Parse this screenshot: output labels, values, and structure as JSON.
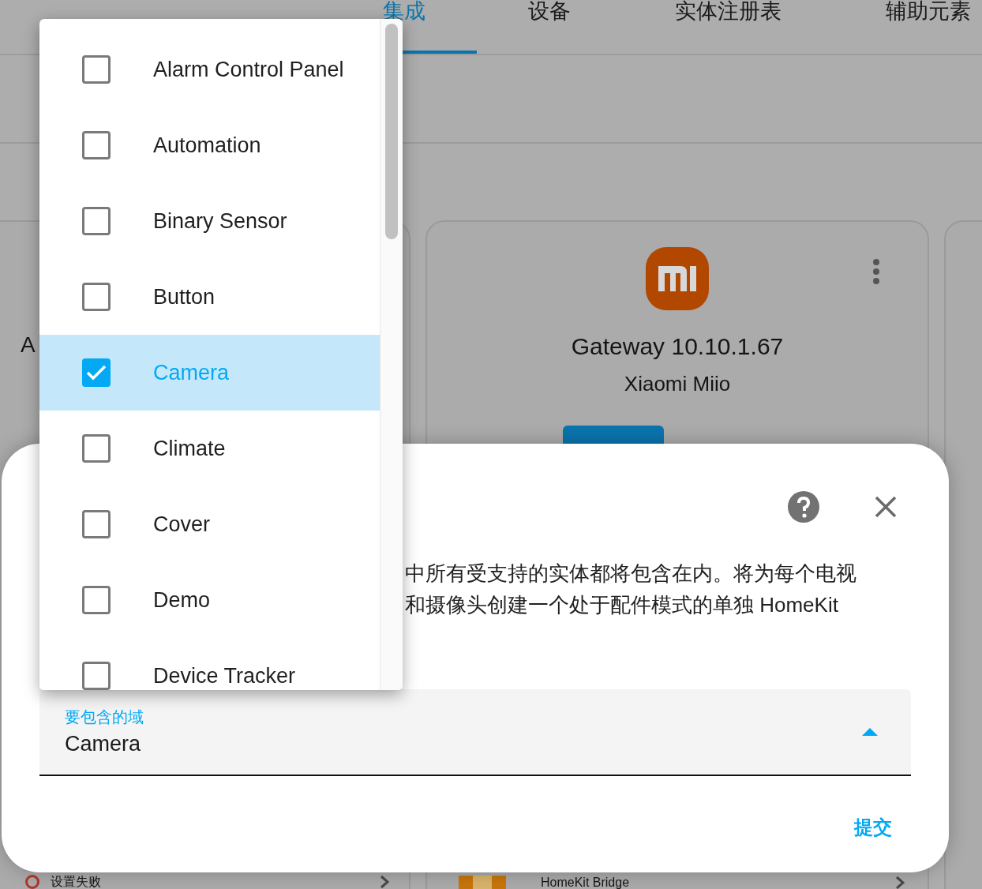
{
  "tabs": [
    {
      "label": "集成",
      "selected": true
    },
    {
      "label": "设备",
      "selected": false
    },
    {
      "label": "实体注册表",
      "selected": false
    },
    {
      "label": "辅助元素",
      "selected": false
    }
  ],
  "left_card": {
    "title": "A",
    "status": "设置失败"
  },
  "gateway_card": {
    "title": "Gateway 10.10.1.67",
    "subtitle": "Xiaomi Miio",
    "entry": "HomeKit Bridge"
  },
  "dialog": {
    "description_lines": [
      "中所有受支持的实体都将包含在内。将为每个电视",
      "和摄像头创建一个处于配件模式的单独 HomeKit"
    ],
    "select": {
      "label": "要包含的域",
      "value": "Camera",
      "expanded": true
    },
    "submit": "提交"
  },
  "dropdown": {
    "options": [
      {
        "label": "Alarm Control Panel",
        "checked": false,
        "selected": false
      },
      {
        "label": "Automation",
        "checked": false,
        "selected": false
      },
      {
        "label": "Binary Sensor",
        "checked": false,
        "selected": false
      },
      {
        "label": "Button",
        "checked": false,
        "selected": false
      },
      {
        "label": "Camera",
        "checked": true,
        "selected": true
      },
      {
        "label": "Climate",
        "checked": false,
        "selected": false
      },
      {
        "label": "Cover",
        "checked": false,
        "selected": false
      },
      {
        "label": "Demo",
        "checked": false,
        "selected": false
      },
      {
        "label": "Device Tracker",
        "checked": false,
        "selected": false
      }
    ]
  }
}
